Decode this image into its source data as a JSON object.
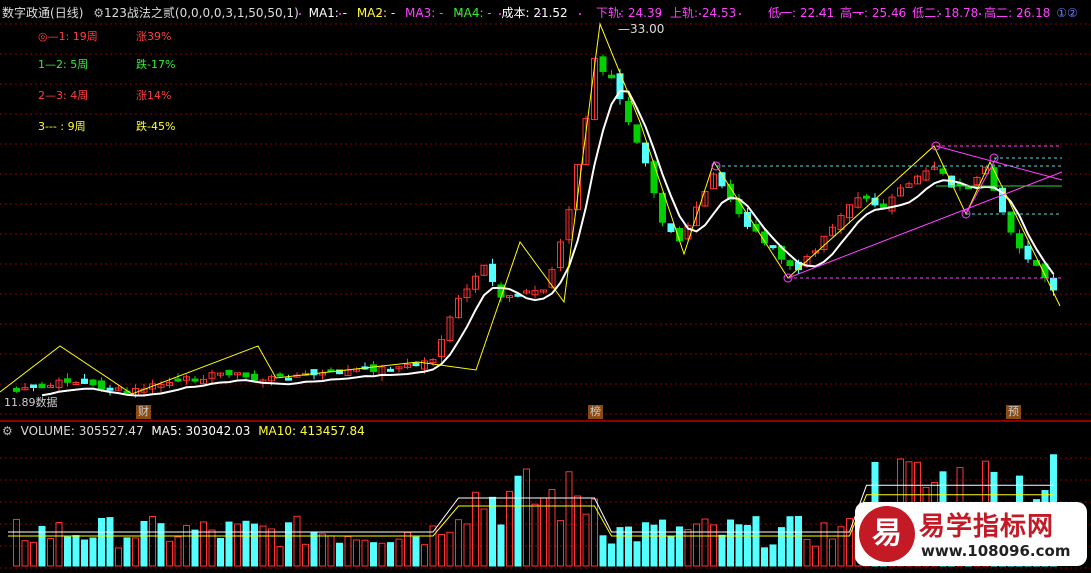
{
  "header": {
    "stock_name": "数字政通",
    "period": "(日线)",
    "indicator": "123战法之贰(0,0,0,0,3,1,50,50,1)",
    "ma1": "MA1: -",
    "ma2": "MA2: -",
    "ma3": "MA3: -",
    "ma4": "MA4: -",
    "cost": "成本: 21.52",
    "lower_track": "下轨: 24.39",
    "upper_track": "上轨: 24.53",
    "low1": "低一: 22.41",
    "high1": "高一: 25.46",
    "low2": "低二: 18.78",
    "high2": "高二: 26.18",
    "circled": "①②"
  },
  "stats": [
    {
      "label": "◎—1: 19周",
      "change": "涨39%",
      "color": "#ff4040"
    },
    {
      "label": "1—2: 5周",
      "change": "跌-17%",
      "color": "#33ee33"
    },
    {
      "label": "2—3: 4周",
      "change": "涨14%",
      "color": "#ff4040"
    },
    {
      "label": "3--- : 9周",
      "change": "跌-45%",
      "color": "#ffff33"
    }
  ],
  "price_labels": {
    "peak": "33.00",
    "low": "11.89",
    "low_suffix": "数据"
  },
  "markers": [
    {
      "text": "财"
    },
    {
      "text": "榜"
    },
    {
      "text": "预"
    }
  ],
  "volume_header": {
    "volume": "VOLUME: 305527.47",
    "ma5": "MA5: 303042.03",
    "ma10": "MA10: 413457.84"
  },
  "watermark": {
    "logo_char": "易",
    "title": "易学指标网",
    "url": "www.108096.com"
  },
  "colors": {
    "up": "#ff3232",
    "down": "#54ffff",
    "green": "#00d000",
    "white": "#ffffff",
    "yellow": "#ffff00",
    "magenta": "#ff40ff",
    "grid": "#8b0000"
  }
}
